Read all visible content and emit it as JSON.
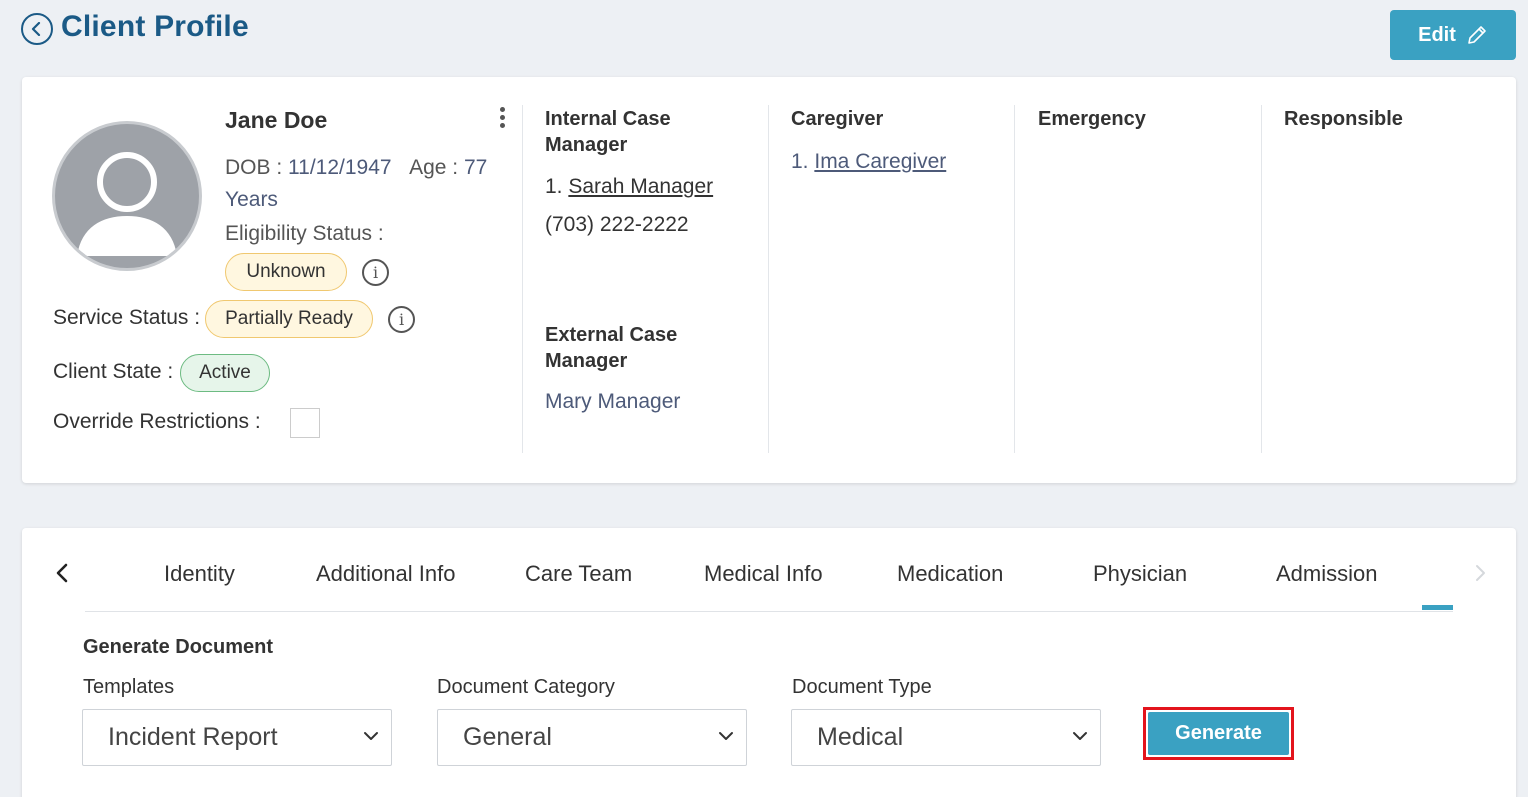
{
  "header": {
    "title": "Client Profile",
    "edit_label": "Edit"
  },
  "profile": {
    "name": "Jane Doe",
    "dob_label": "DOB :",
    "dob_value": "11/12/1947",
    "age_label": "Age :",
    "age_value": "77",
    "age_unit": "Years",
    "eligibility_label": "Eligibility Status :",
    "eligibility_value": "Unknown",
    "service_status_label": "Service Status :",
    "service_status_value": "Partially Ready",
    "client_state_label": "Client State :",
    "client_state_value": "Active",
    "override_label": "Override Restrictions :",
    "info_glyph": "i"
  },
  "case_managers": {
    "internal_title_line1": "Internal Case",
    "internal_title_line2": "Manager",
    "internal_number": "1.",
    "internal_name": "Sarah Manager",
    "internal_phone": "(703) 222-2222",
    "external_title_line1": "External Case",
    "external_title_line2": "Manager",
    "external_name": "Mary Manager"
  },
  "caregiver": {
    "title": "Caregiver",
    "number": "1.",
    "name": "Ima Caregiver"
  },
  "emergency": {
    "title": "Emergency"
  },
  "responsible": {
    "title": "Responsible"
  },
  "tabs": [
    {
      "label": "Identity"
    },
    {
      "label": "Additional Info"
    },
    {
      "label": "Care Team"
    },
    {
      "label": "Medical Info"
    },
    {
      "label": "Medication"
    },
    {
      "label": "Physician"
    },
    {
      "label": "Admission"
    }
  ],
  "generate": {
    "section_title": "Generate Document",
    "templates_label": "Templates",
    "templates_value": "Incident Report",
    "category_label": "Document Category",
    "category_value": "General",
    "type_label": "Document Type",
    "type_value": "Medical",
    "button_label": "Generate"
  },
  "colors": {
    "primary": "#3aa1c2",
    "title": "#1b5a86",
    "highlight": "#e3141c",
    "badge_warn_bg": "#fff7e0",
    "badge_ok_bg": "#e6f5ea"
  },
  "icons": [
    "back-arrow-icon",
    "pencil-icon",
    "kebab-menu-icon",
    "info-icon",
    "chevron-left-icon",
    "chevron-right-icon",
    "chevron-down-icon",
    "avatar-placeholder-icon"
  ]
}
